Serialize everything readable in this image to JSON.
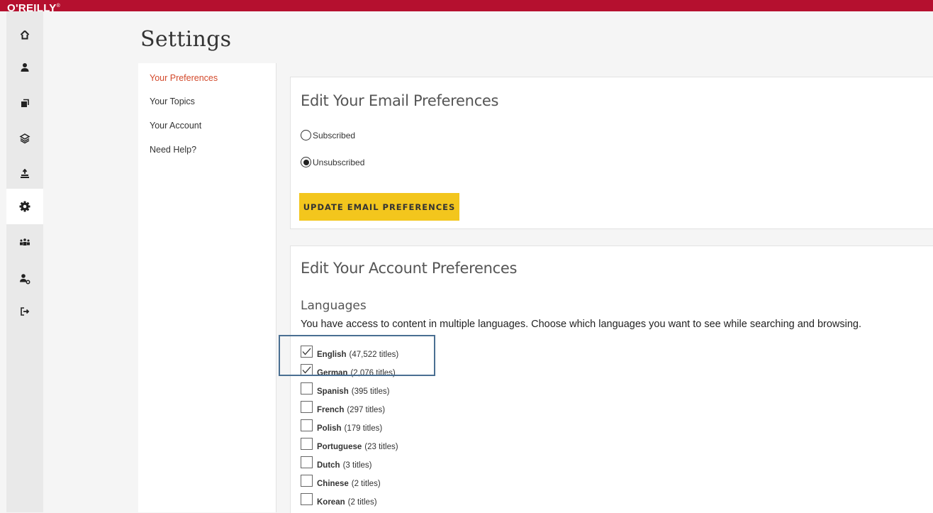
{
  "brand": {
    "logo": "O'REILLY",
    "trademark": "®"
  },
  "rail": {
    "items": [
      {
        "name": "home",
        "icon": "home-icon",
        "active": false
      },
      {
        "name": "profile",
        "icon": "person-icon",
        "active": false
      },
      {
        "name": "playlists",
        "icon": "playlist-icon",
        "active": false
      },
      {
        "name": "topics",
        "icon": "layers-icon",
        "active": false
      },
      {
        "name": "highlights",
        "icon": "upload-icon",
        "active": false
      },
      {
        "name": "settings",
        "icon": "gear-icon",
        "active": true
      },
      {
        "name": "team",
        "icon": "team-icon",
        "active": false
      },
      {
        "name": "admin",
        "icon": "user-gear-icon",
        "active": false
      },
      {
        "name": "sign-out",
        "icon": "sign-out-icon",
        "active": false
      }
    ]
  },
  "page": {
    "title": "Settings"
  },
  "sidebar": {
    "items": [
      {
        "label": "Your Preferences",
        "active": true
      },
      {
        "label": "Your Topics",
        "active": false
      },
      {
        "label": "Your Account",
        "active": false
      },
      {
        "label": "Need Help?",
        "active": false
      }
    ]
  },
  "email": {
    "title": "Edit Your Email Preferences",
    "options": [
      {
        "label": "Subscribed",
        "selected": false
      },
      {
        "label": "Unsubscribed",
        "selected": true
      }
    ],
    "button_label": "UPDATE EMAIL PREFERENCES"
  },
  "account": {
    "title": "Edit Your Account Preferences",
    "languages_label": "Languages",
    "languages_desc": "You have access to content in multiple languages. Choose which languages you want to see while searching and browsing.",
    "languages": [
      {
        "name": "English",
        "count": "(47,522 titles)",
        "checked": true
      },
      {
        "name": "German",
        "count": "(2,076 titles)",
        "checked": true
      },
      {
        "name": "Spanish",
        "count": "(395 titles)",
        "checked": false
      },
      {
        "name": "French",
        "count": "(297 titles)",
        "checked": false
      },
      {
        "name": "Polish",
        "count": "(179 titles)",
        "checked": false
      },
      {
        "name": "Portuguese",
        "count": "(23 titles)",
        "checked": false
      },
      {
        "name": "Dutch",
        "count": "(3 titles)",
        "checked": false
      },
      {
        "name": "Chinese",
        "count": "(2 titles)",
        "checked": false
      },
      {
        "name": "Korean",
        "count": "(2 titles)",
        "checked": false
      }
    ]
  },
  "colors": {
    "brand_red": "#b5102f",
    "accent_orange": "#d3492b",
    "button_yellow": "#f3c61d",
    "highlight_blue": "#4a6f92"
  }
}
